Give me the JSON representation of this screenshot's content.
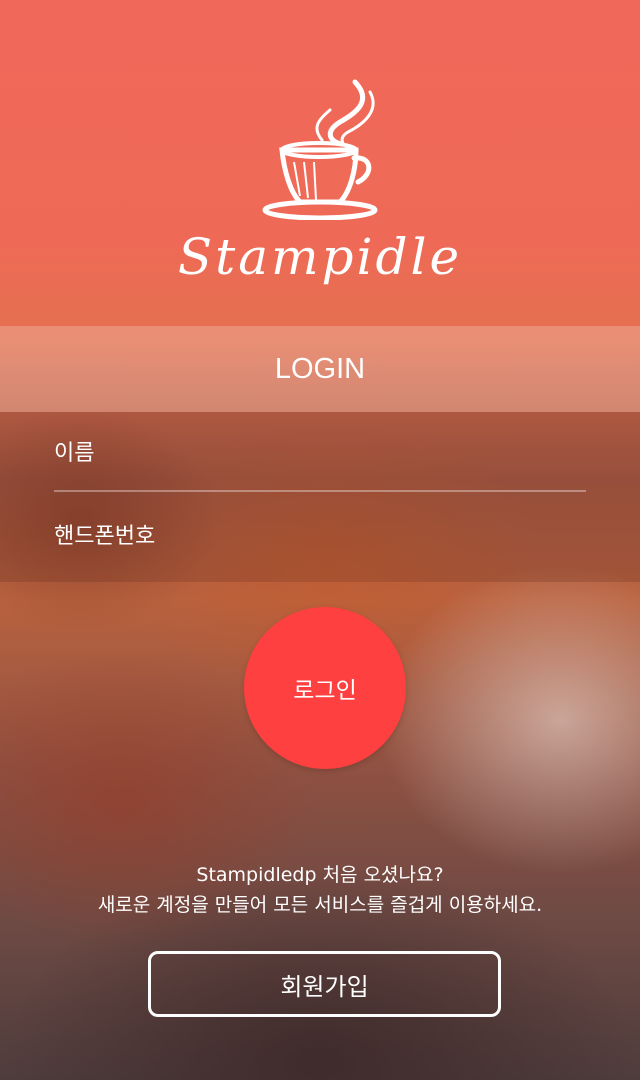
{
  "brand": {
    "name": "Stampidle",
    "logo_icon": "coffee-cup-icon"
  },
  "login_header": "LOGIN",
  "form": {
    "name_placeholder": "이름",
    "phone_placeholder": "핸드폰번호"
  },
  "login_button": "로그인",
  "signup": {
    "line1": "Stampidledp 처음 오셨나요?",
    "line2": "새로운 계정을 만들어 모든 서비스를 즐겁게 이용하세요.",
    "button": "회원가입"
  },
  "colors": {
    "accent": "#ff4040",
    "background_top": "#f0685a"
  }
}
